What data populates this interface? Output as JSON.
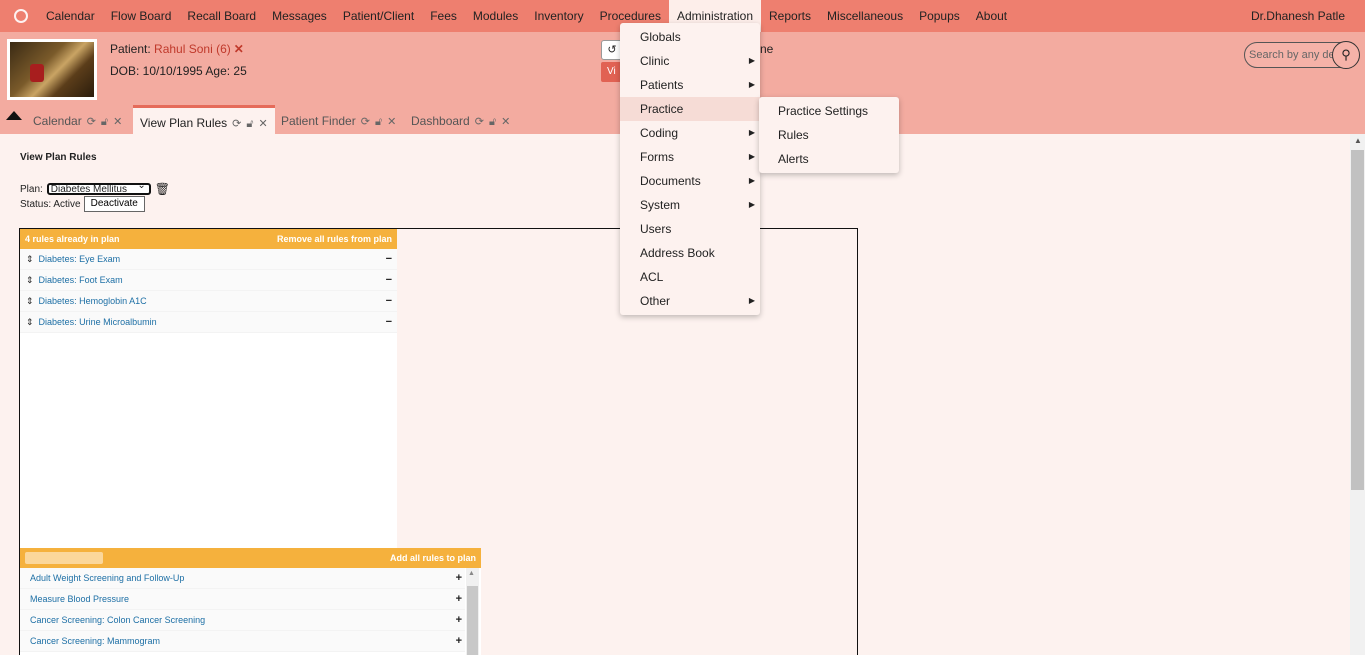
{
  "nav": {
    "items": [
      "Calendar",
      "Flow Board",
      "Recall Board",
      "Messages",
      "Patient/Client",
      "Fees",
      "Modules",
      "Inventory",
      "Procedures",
      "Administration",
      "Reports",
      "Miscellaneous",
      "Popups",
      "About"
    ],
    "active": "Administration",
    "user": "Dr.Dhanesh Patle"
  },
  "patient": {
    "label": "Patient:",
    "name": "Rahul Soni (6)",
    "dob_line": "DOB: 10/10/1995 Age: 25"
  },
  "encounter": {
    "history_icon": "history-icon",
    "button_text": "Vi",
    "text": "ne"
  },
  "search": {
    "placeholder": "Search by any de"
  },
  "tabs": [
    {
      "label": "Calendar"
    },
    {
      "label": "View Plan Rules"
    },
    {
      "label": "Patient Finder"
    },
    {
      "label": "Dashboard"
    }
  ],
  "page": {
    "title": "View Plan Rules",
    "plan_label": "Plan:",
    "plan_value": "Diabetes Mellitus",
    "status_text": "Status: Active",
    "deactivate": "Deactivate"
  },
  "in_plan": {
    "header_left": "4 rules already in plan",
    "header_right": "Remove all rules from plan",
    "rules": [
      "Diabetes: Eye Exam",
      "Diabetes: Foot Exam",
      "Diabetes: Hemoglobin A1C",
      "Diabetes: Urine Microalbumin"
    ]
  },
  "available": {
    "header_right": "Add all rules to plan",
    "rules": [
      "Adult Weight Screening and Follow-Up",
      "Measure Blood Pressure",
      "Cancer Screening: Colon Cancer Screening",
      "Cancer Screening: Mammogram"
    ]
  },
  "admin_menu": [
    "Globals",
    "Clinic",
    "Patients",
    "Practice",
    "Coding",
    "Forms",
    "Documents",
    "System",
    "Users",
    "Address Book",
    "ACL",
    "Other"
  ],
  "admin_submenu_flags": [
    false,
    true,
    true,
    false,
    true,
    true,
    true,
    true,
    false,
    false,
    false,
    true
  ],
  "practice_submenu": [
    "Practice Settings",
    "Rules",
    "Alerts"
  ],
  "colors": {
    "nav": "#ee7f6f",
    "header": "#f3aba0",
    "accent": "#f5b13d",
    "link": "#1d6fa5"
  }
}
